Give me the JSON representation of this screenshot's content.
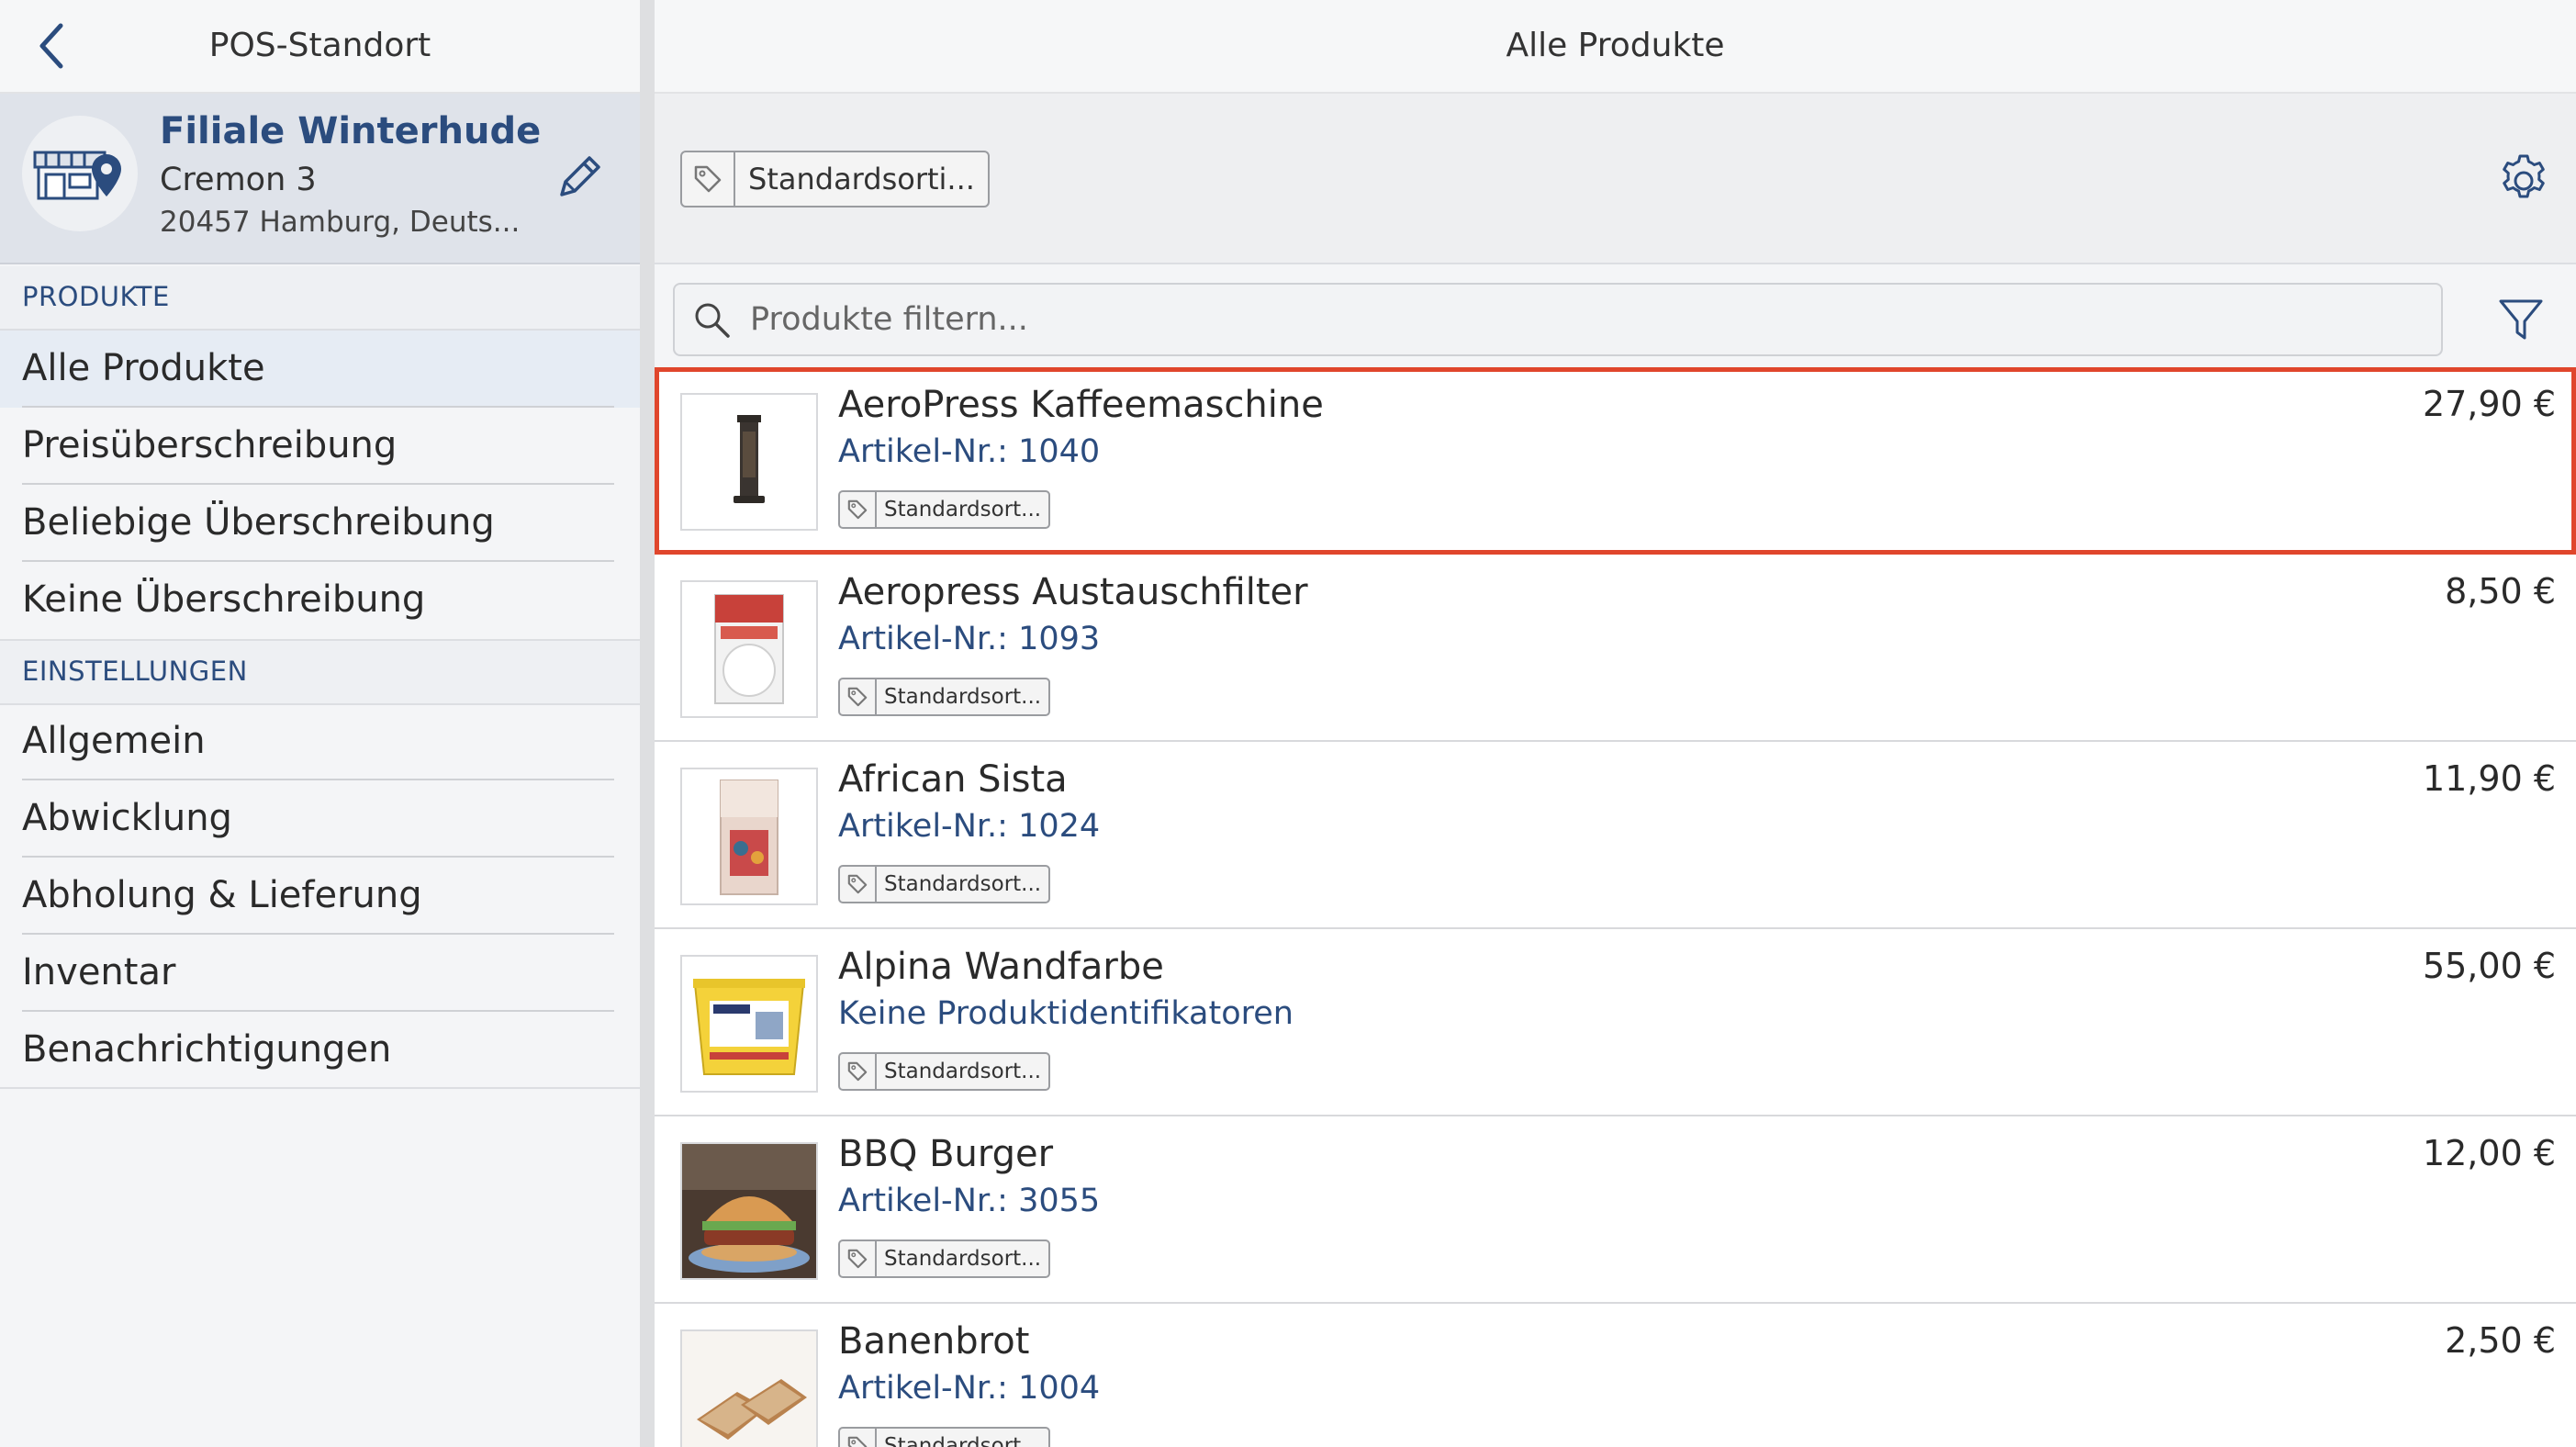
{
  "sidebar": {
    "title": "POS-Standort",
    "store": {
      "name": "Filiale Winterhude",
      "street": "Cremon 3",
      "city": "20457 Hamburg, Deuts..."
    },
    "sections": [
      {
        "label": "PRODUKTE",
        "items": [
          {
            "label": "Alle Produkte"
          },
          {
            "label": "Preisüberschreibung"
          },
          {
            "label": "Beliebige Überschreibung"
          },
          {
            "label": "Keine Überschreibung"
          }
        ]
      },
      {
        "label": "EINSTELLUNGEN",
        "items": [
          {
            "label": "Allgemein"
          },
          {
            "label": "Abwicklung"
          },
          {
            "label": "Abholung & Lieferung"
          },
          {
            "label": "Inventar"
          },
          {
            "label": "Benachrichtigungen"
          }
        ]
      }
    ]
  },
  "main": {
    "title": "Alle Produkte",
    "assortment_chip": "Standardsorti...",
    "search": {
      "placeholder": "Produkte filtern..."
    },
    "products": [
      {
        "name": "AeroPress Kaffeemaschine",
        "sku": "Artikel-Nr.: 1040",
        "price": "27,90 €",
        "tag": "Standardsort...",
        "selected": true
      },
      {
        "name": "Aeropress Austauschfilter",
        "sku": "Artikel-Nr.: 1093",
        "price": "8,50 €",
        "tag": "Standardsort..."
      },
      {
        "name": "African Sista",
        "sku": "Artikel-Nr.: 1024",
        "price": "11,90 €",
        "tag": "Standardsort..."
      },
      {
        "name": "Alpina Wandfarbe",
        "sku": "Keine Produktidentifikatoren",
        "price": "55,00 €",
        "tag": "Standardsort..."
      },
      {
        "name": "BBQ Burger",
        "sku": "Artikel-Nr.: 3055",
        "price": "12,00 €",
        "tag": "Standardsort..."
      },
      {
        "name": "Banenbrot",
        "sku": "Artikel-Nr.: 1004",
        "price": "2,50 €",
        "tag": "Standardsort..."
      }
    ]
  },
  "colors": {
    "accent": "#2b4c7e",
    "selection": "#e0462c"
  }
}
